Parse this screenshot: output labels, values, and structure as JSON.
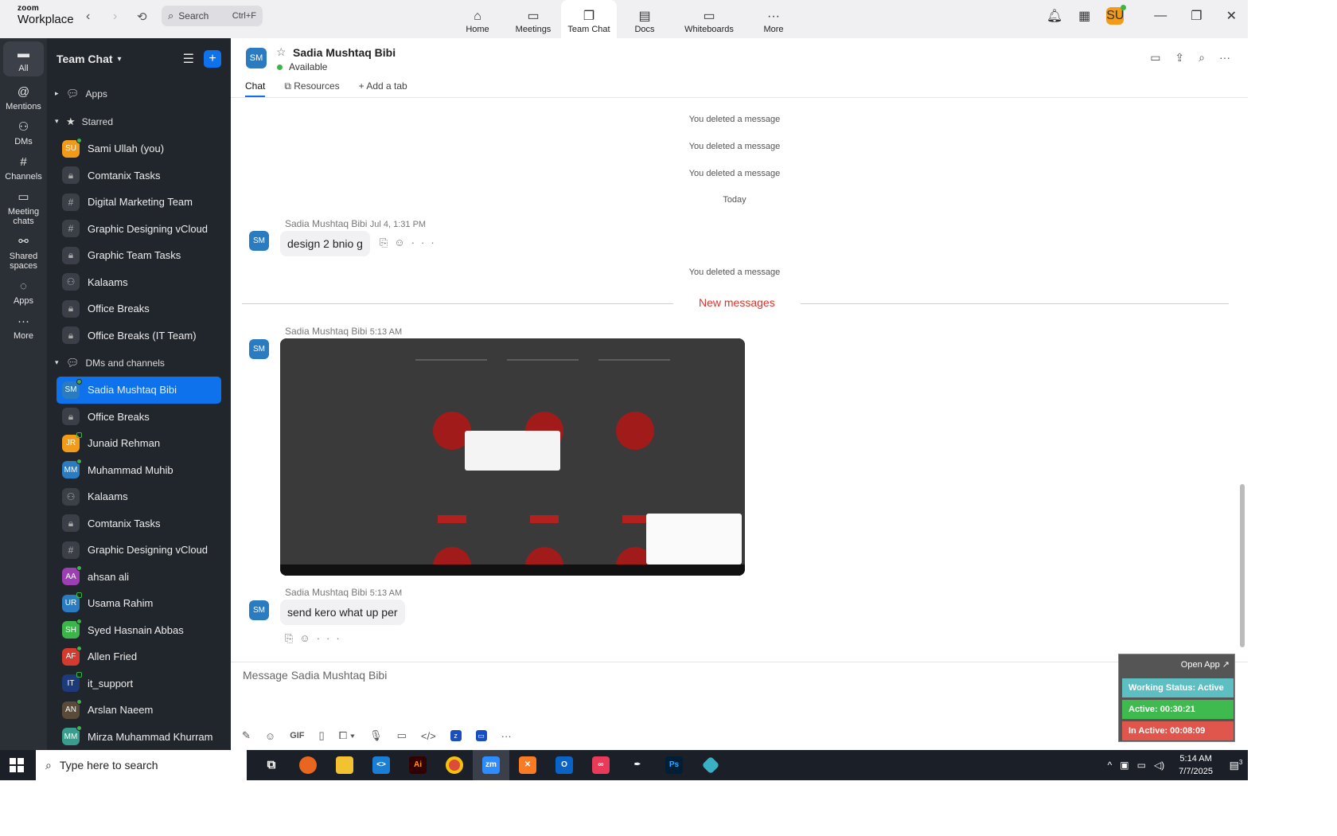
{
  "app": {
    "logo_top": "zoom",
    "logo_bottom": "Workplace"
  },
  "search": {
    "label": "Search",
    "shortcut": "Ctrl+F"
  },
  "top_tabs": [
    {
      "label": "Home",
      "icon": "home-icon"
    },
    {
      "label": "Meetings",
      "icon": "video-icon"
    },
    {
      "label": "Team Chat",
      "icon": "chat-icon"
    },
    {
      "label": "Docs",
      "icon": "doc-icon"
    },
    {
      "label": "Whiteboards",
      "icon": "whiteboard-icon"
    },
    {
      "label": "More",
      "icon": "more-icon"
    }
  ],
  "user": {
    "initials": "SU"
  },
  "rail": [
    {
      "label": "All"
    },
    {
      "label": "Mentions"
    },
    {
      "label": "DMs"
    },
    {
      "label": "Channels"
    },
    {
      "label": "Meeting chats"
    },
    {
      "label": "Shared spaces"
    },
    {
      "label": "Apps"
    },
    {
      "label": "More"
    }
  ],
  "sidebar": {
    "title": "Team Chat",
    "sections": {
      "apps": "Apps",
      "starred": "Starred",
      "dms": "DMs and channels"
    },
    "starred": [
      {
        "label": "Sami Ullah (you)",
        "initials": "SU",
        "color": "#f29a1a",
        "kind": "user"
      },
      {
        "label": "Comtanix Tasks",
        "kind": "lock"
      },
      {
        "label": "Digital Marketing Team",
        "kind": "hash"
      },
      {
        "label": "Graphic Designing vCloud",
        "kind": "hash"
      },
      {
        "label": "Graphic Team Tasks",
        "kind": "lock"
      },
      {
        "label": "Kalaams",
        "kind": "group"
      },
      {
        "label": "Office Breaks",
        "kind": "lock"
      },
      {
        "label": "Office Breaks (IT Team)",
        "kind": "lock"
      }
    ],
    "dms": [
      {
        "label": "Sadia Mushtaq Bibi",
        "initials": "SM",
        "color": "#2a7bbf",
        "kind": "user"
      },
      {
        "label": "Office Breaks",
        "kind": "lock"
      },
      {
        "label": "Junaid Rehman",
        "initials": "JR",
        "color": "#f29a1a",
        "kind": "user"
      },
      {
        "label": "Muhammad Muhib",
        "initials": "MM",
        "color": "#2a7bbf",
        "kind": "user"
      },
      {
        "label": "Kalaams",
        "kind": "group"
      },
      {
        "label": "Comtanix Tasks",
        "kind": "lock"
      },
      {
        "label": "Graphic Designing vCloud",
        "kind": "hash"
      },
      {
        "label": "ahsan ali",
        "initials": "AA",
        "color": "#9b3fb3",
        "kind": "user"
      },
      {
        "label": "Usama Rahim",
        "initials": "UR",
        "color": "#2a7bbf",
        "kind": "user"
      },
      {
        "label": "Syed Hasnain Abbas",
        "initials": "SH",
        "color": "#3bb54a",
        "kind": "user"
      },
      {
        "label": "Allen Fried",
        "initials": "AF",
        "color": "#d23b2e",
        "kind": "user"
      },
      {
        "label": "it_support",
        "initials": "IT",
        "color": "#1d3b7a",
        "kind": "user"
      },
      {
        "label": "Arslan Naeem",
        "initials": "AN",
        "color": "#5a4a3a",
        "kind": "user"
      },
      {
        "label": "Mirza Muhammad Khurram",
        "initials": "MM",
        "color": "#3a9c8c",
        "kind": "user"
      }
    ]
  },
  "chat": {
    "name": "Sadia Mushtaq Bibi",
    "initials": "SM",
    "status": "Available",
    "tabs": {
      "chat": "Chat",
      "resources": "Resources",
      "add": "Add a tab"
    },
    "deleted": "You deleted a message",
    "today": "Today",
    "new_messages": "New messages",
    "msg1": {
      "sender": "Sadia Mushtaq Bibi",
      "time": "Jul 4, 1:31 PM",
      "text": "design 2 bnio g"
    },
    "msg2": {
      "sender": "Sadia Mushtaq Bibi",
      "time": "5:13 AM"
    },
    "msg3": {
      "sender": "Sadia Mushtaq Bibi",
      "time": "5:13 AM",
      "text": "send kero what up per"
    },
    "composer_placeholder": "Message Sadia Mushtaq Bibi"
  },
  "widget": {
    "open": "Open App ↗",
    "status": "Working Status: Active",
    "active": "Active: 00:30:21",
    "inactive": "In Active: 00:08:09"
  },
  "taskbar": {
    "search": "Type here to search",
    "time": "5:14 AM",
    "date": "7/7/2025",
    "notif_count": "3"
  }
}
